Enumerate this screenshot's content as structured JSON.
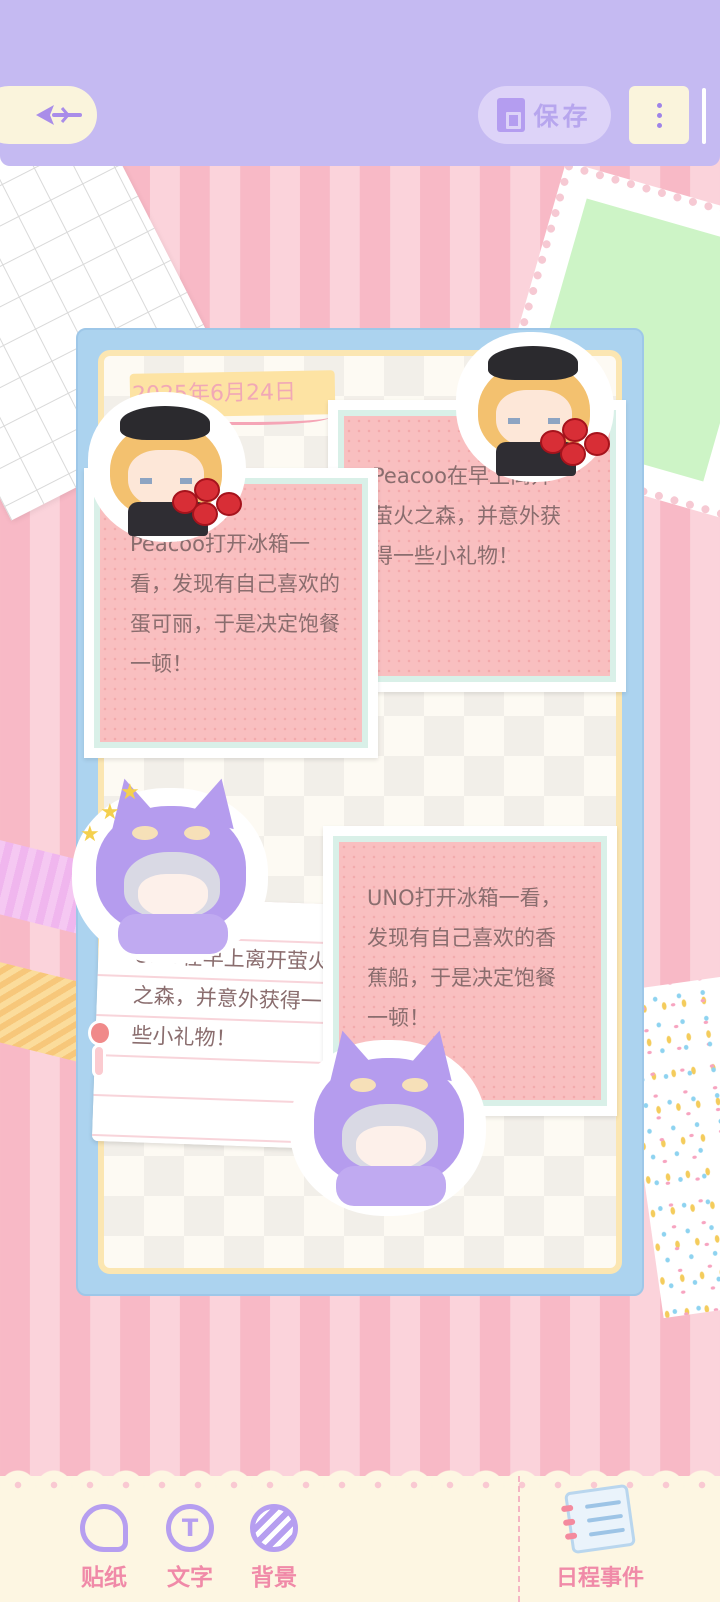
{
  "header": {
    "save_label": "保存"
  },
  "card": {
    "date": "2025年6月24日",
    "notes": [
      "Peacoo打开冰箱一看，发现有自己喜欢的蛋可丽，于是决定饱餐一顿！",
      "Peacoo在早上离开萤火之森，并意外获得一些小礼物！",
      "UNO在早上离开萤火之森，并意外获得一些小礼物！",
      "UNO打开冰箱一看，发现有自己喜欢的香蕉船，于是决定饱餐一顿！"
    ]
  },
  "toolbar": {
    "items": [
      {
        "label": "贴纸",
        "icon": "sticker-icon"
      },
      {
        "label": "文字",
        "icon": "text-icon"
      },
      {
        "label": "背景",
        "icon": "background-icon"
      }
    ],
    "schedule_label": "日程事件",
    "schedule_icon": "calendar-list-icon"
  },
  "colors": {
    "header": "#c5baf2",
    "accent_pink": "#f08aa8",
    "accent_purple": "#b69ef0"
  }
}
